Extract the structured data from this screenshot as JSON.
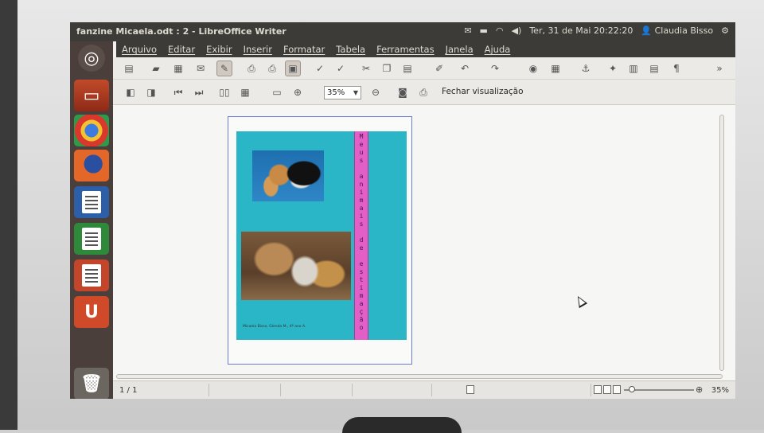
{
  "window": {
    "title": "fanzine Micaela.odt : 2 - LibreOffice Writer"
  },
  "indicators": {
    "datetime": "Ter, 31 de Mai 20:22:20",
    "user": "Claudia Bisso",
    "mail_icon": "mail-icon",
    "battery_icon": "battery-icon",
    "wifi_icon": "wifi-icon",
    "volume_icon": "volume-icon",
    "power_icon": "power-icon"
  },
  "menu": [
    "Arquivo",
    "Editar",
    "Exibir",
    "Inserir",
    "Formatar",
    "Tabela",
    "Ferramentas",
    "Janela",
    "Ajuda"
  ],
  "preview_toolbar": {
    "zoom": "35%",
    "close_label": "Fechar visualização"
  },
  "page": {
    "vertical_title_letters": [
      "M",
      "e",
      "u",
      "s",
      " ",
      "a",
      "n",
      "i",
      "m",
      "a",
      "i",
      "s",
      " ",
      "d",
      "e",
      " ",
      "e",
      "s",
      "t",
      "i",
      "m",
      "a",
      "ç",
      "ã",
      "o"
    ],
    "caption": "Micaela Bisso, Glenda M., 4º ano A."
  },
  "status": {
    "page": "1 / 1",
    "zoom": "35%"
  },
  "colors": {
    "page_background": "#2bb6c8",
    "title_band": "#e25fc7",
    "panel": "#3c3b37"
  }
}
